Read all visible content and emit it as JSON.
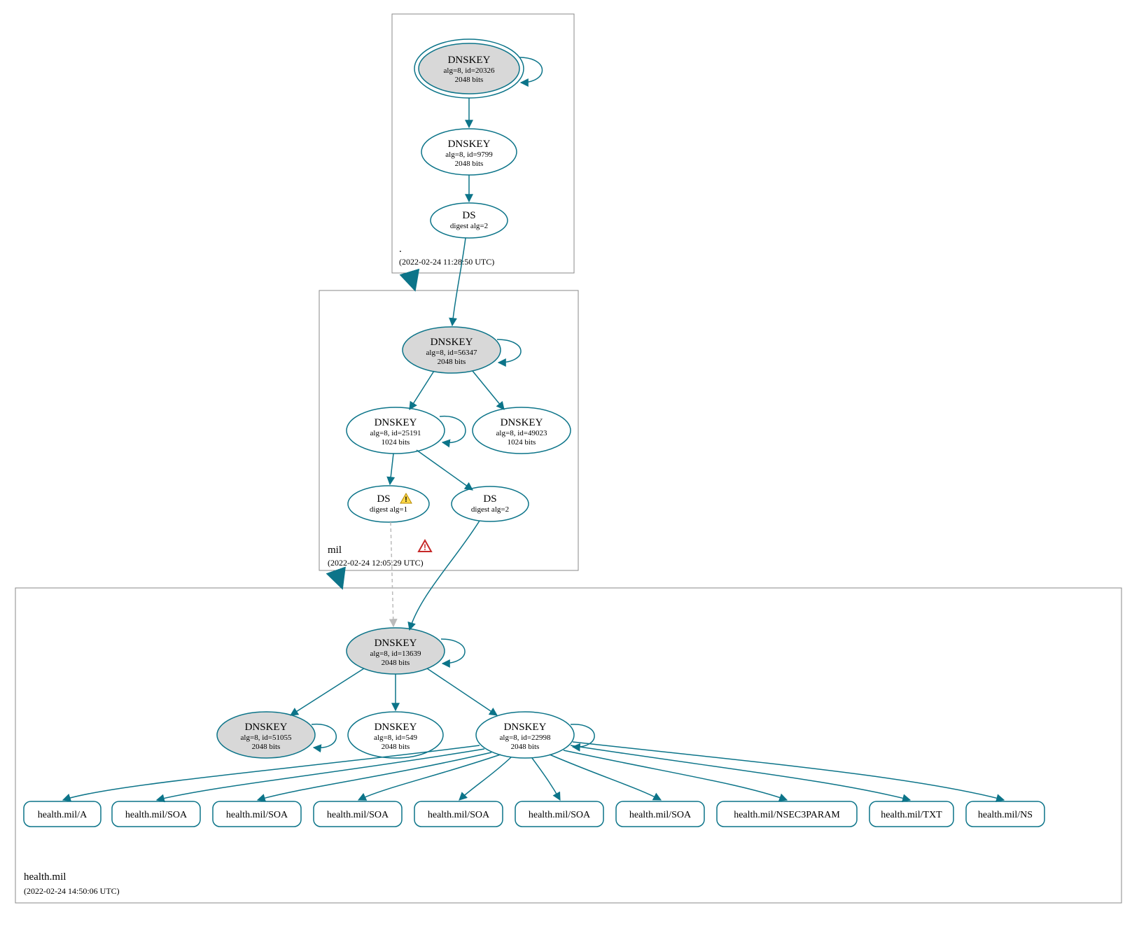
{
  "zones": {
    "root": {
      "label": ".",
      "timestamp": "(2022-02-24 11:28:50 UTC)"
    },
    "mil": {
      "label": "mil",
      "timestamp": "(2022-02-24 12:05:29 UTC)"
    },
    "health": {
      "label": "health.mil",
      "timestamp": "(2022-02-24 14:50:06 UTC)"
    }
  },
  "nodes": {
    "root_dnskey_ksk": {
      "title": "DNSKEY",
      "sub1": "alg=8, id=20326",
      "sub2": "2048 bits",
      "grey": true,
      "double": true
    },
    "root_dnskey_zsk": {
      "title": "DNSKEY",
      "sub1": "alg=8, id=9799",
      "sub2": "2048 bits",
      "grey": false
    },
    "root_ds": {
      "title": "DS",
      "sub1": "digest alg=2"
    },
    "mil_dnskey_ksk": {
      "title": "DNSKEY",
      "sub1": "alg=8, id=56347",
      "sub2": "2048 bits",
      "grey": true
    },
    "mil_dnskey_a": {
      "title": "DNSKEY",
      "sub1": "alg=8, id=25191",
      "sub2": "1024 bits",
      "grey": false
    },
    "mil_dnskey_b": {
      "title": "DNSKEY",
      "sub1": "alg=8, id=49023",
      "sub2": "1024 bits",
      "grey": false
    },
    "mil_ds_warn": {
      "title": "DS",
      "sub1": "digest alg=1",
      "warn": true
    },
    "mil_ds_ok": {
      "title": "DS",
      "sub1": "digest alg=2"
    },
    "h_dnskey_ksk": {
      "title": "DNSKEY",
      "sub1": "alg=8, id=13639",
      "sub2": "2048 bits",
      "grey": true
    },
    "h_dnskey_a": {
      "title": "DNSKEY",
      "sub1": "alg=8, id=51055",
      "sub2": "2048 bits",
      "grey": true
    },
    "h_dnskey_b": {
      "title": "DNSKEY",
      "sub1": "alg=8, id=549",
      "sub2": "2048 bits",
      "grey": false
    },
    "h_dnskey_c": {
      "title": "DNSKEY",
      "sub1": "alg=8, id=22998",
      "sub2": "2048 bits",
      "grey": false
    }
  },
  "rrsets": [
    "health.mil/A",
    "health.mil/SOA",
    "health.mil/SOA",
    "health.mil/SOA",
    "health.mil/SOA",
    "health.mil/SOA",
    "health.mil/SOA",
    "health.mil/NSEC3PARAM",
    "health.mil/TXT",
    "health.mil/NS"
  ],
  "colors": {
    "stroke": "#0c7489",
    "node_grey": "#d8d8d8"
  }
}
